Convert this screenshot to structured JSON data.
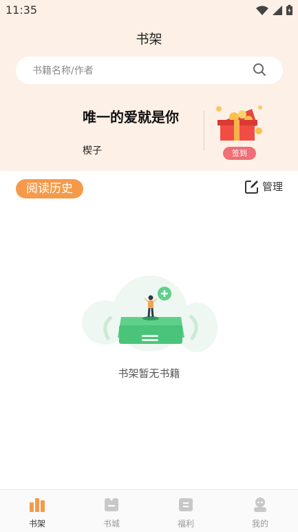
{
  "status_bar": {
    "time": "11:35"
  },
  "header": {
    "title": "书架"
  },
  "search": {
    "placeholder": "书籍名称/作者"
  },
  "featured": {
    "book_title": "唯一的爱就是你",
    "author": "楔子",
    "signin_label": "签到"
  },
  "history": {
    "label": "阅读历史",
    "manage_label": "管理"
  },
  "empty_state": {
    "message": "书架暂无书籍"
  },
  "tabbar": {
    "items": [
      {
        "label": "书架",
        "icon": "bookshelf-icon",
        "active": true
      },
      {
        "label": "书城",
        "icon": "store-icon",
        "active": false
      },
      {
        "label": "福利",
        "icon": "welfare-icon",
        "active": false
      },
      {
        "label": "我的",
        "icon": "profile-icon",
        "active": false
      }
    ]
  },
  "colors": {
    "accent": "#f59a4b",
    "header_bg": "#fdf0e6",
    "signin": "#f06e75",
    "tab_active": "#f59a4b",
    "tab_inactive": "#c8c8c8"
  }
}
